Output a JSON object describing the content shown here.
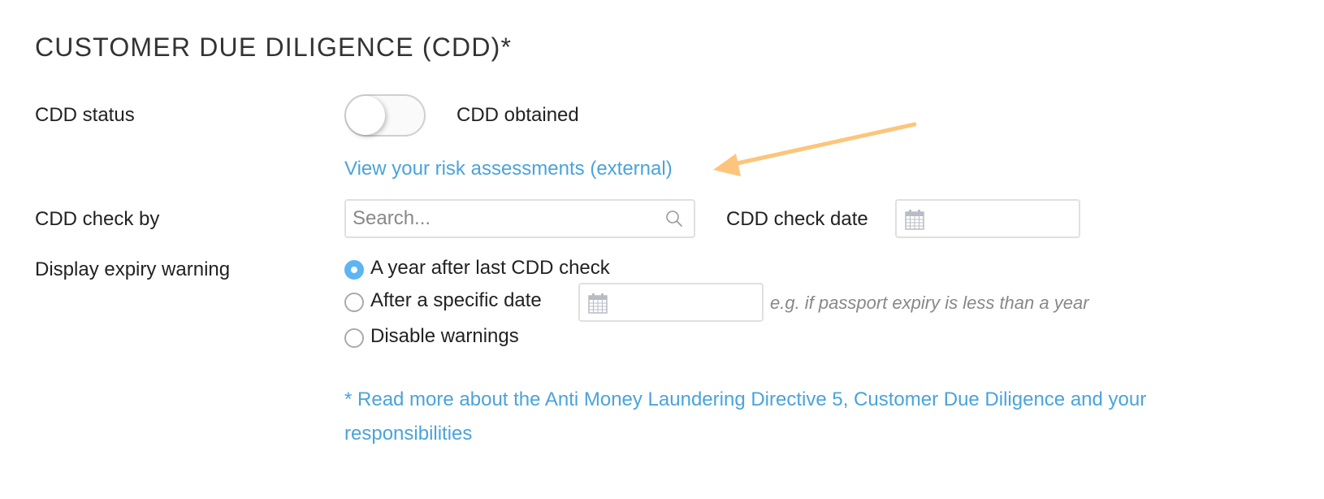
{
  "section": {
    "title": "CUSTOMER DUE DILIGENCE (CDD)*"
  },
  "cdd_status": {
    "label": "CDD status",
    "toggle_on": false,
    "toggle_label": "CDD obtained"
  },
  "risk_link": {
    "text": "View your risk assessments (external)"
  },
  "annotation": {
    "arrow_color": "#fdc57b"
  },
  "check_by": {
    "label": "CDD check by",
    "placeholder": "Search...",
    "value": ""
  },
  "check_date": {
    "label": "CDD check date",
    "value": ""
  },
  "expiry": {
    "label": "Display expiry warning",
    "options": [
      {
        "label": "A year after last CDD check",
        "checked": true
      },
      {
        "label": "After a specific date",
        "checked": false
      },
      {
        "label": "Disable warnings",
        "checked": false
      }
    ],
    "specific_date_value": "",
    "hint": "e.g. if passport expiry is less than a year"
  },
  "footer_link": {
    "line1": "* Read more about the Anti Money Laundering Directive 5, Customer Due Diligence and your",
    "line2": "responsibilities"
  },
  "colors": {
    "link": "#4aa3dc",
    "radio_checked": "#5db5f2"
  }
}
